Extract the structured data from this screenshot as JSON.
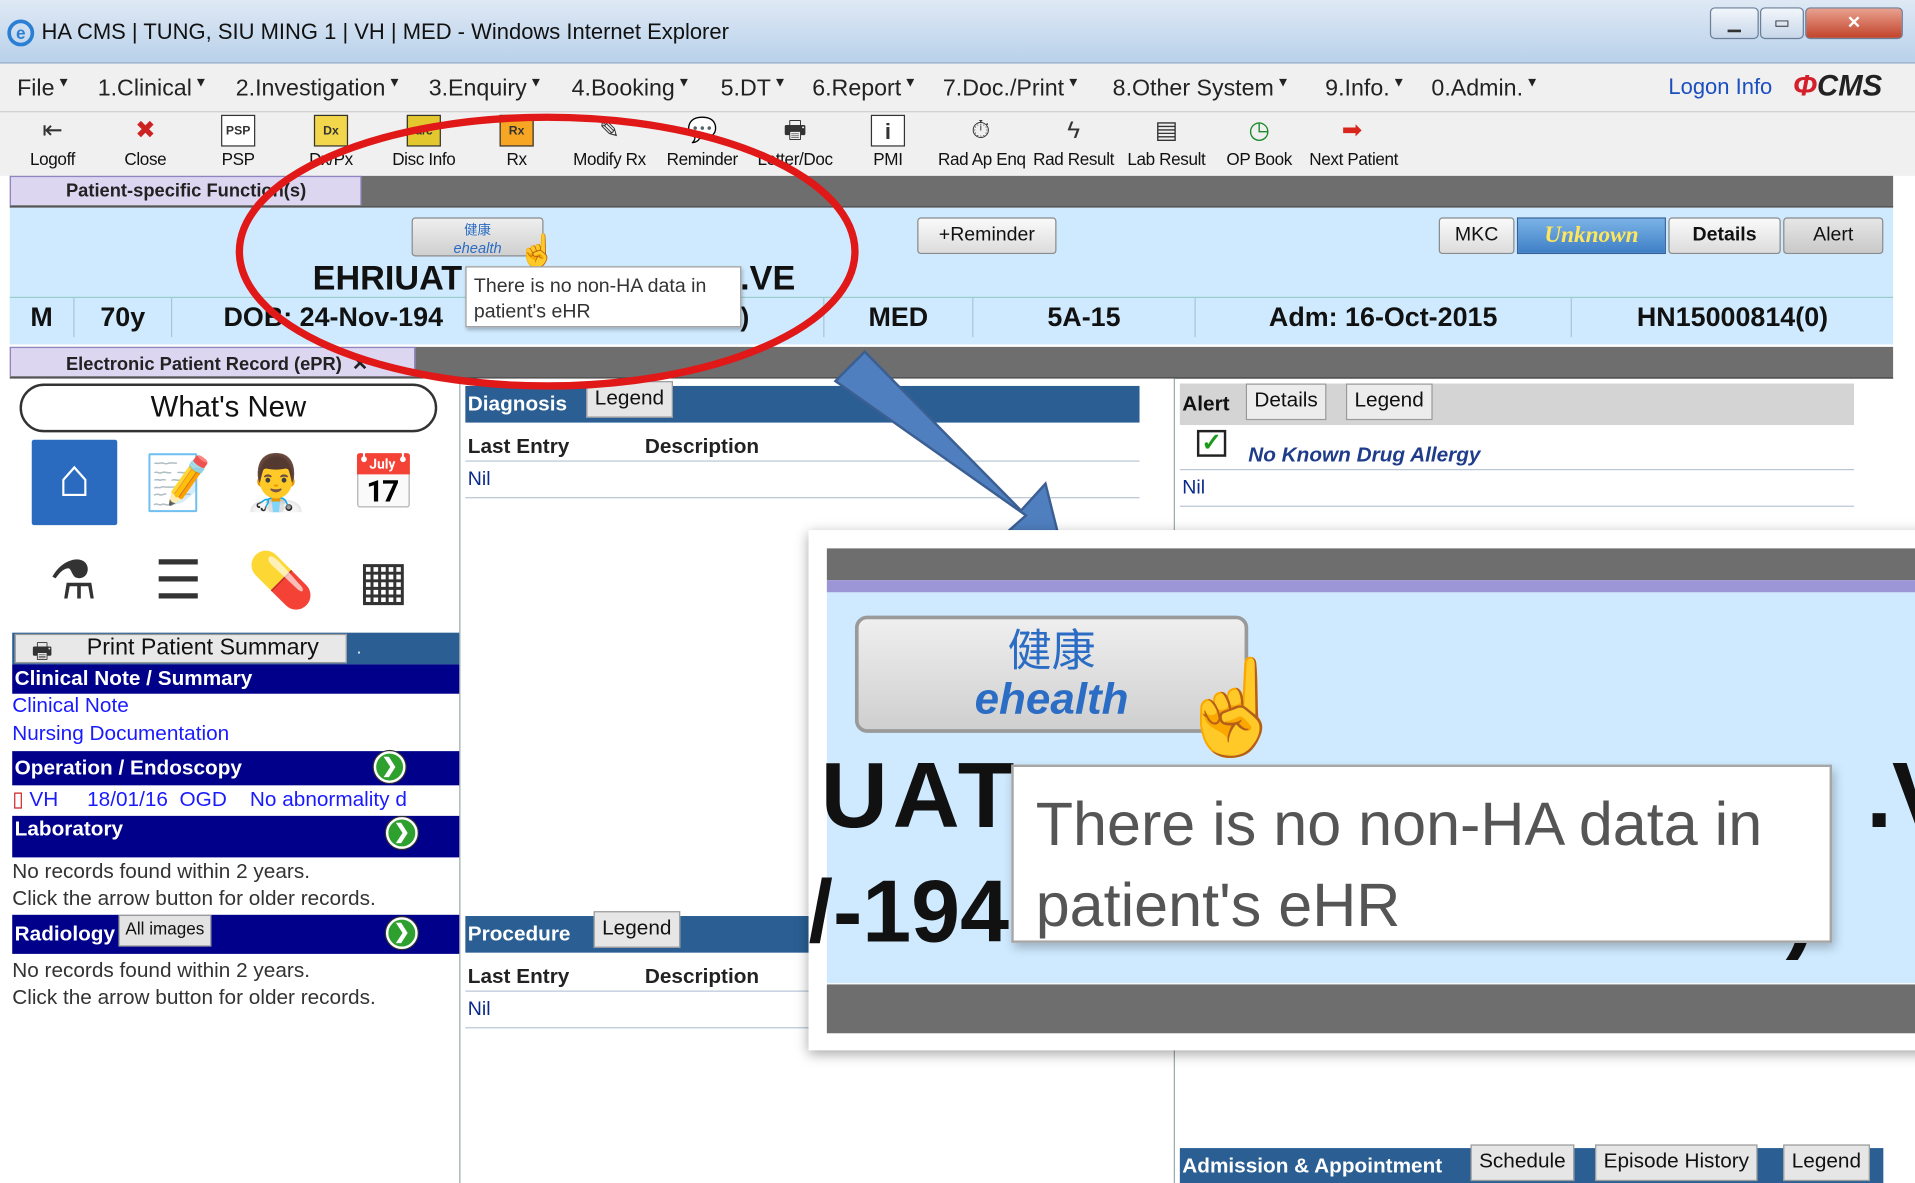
{
  "window": {
    "title": "HA CMS | TUNG, SIU MING 1 | VH | MED - Windows Internet Explorer"
  },
  "menu": [
    {
      "label": "File"
    },
    {
      "label": "1.Clinical"
    },
    {
      "label": "2.Investigation"
    },
    {
      "label": "3.Enquiry"
    },
    {
      "label": "4.Booking"
    },
    {
      "label": "5.DT"
    },
    {
      "label": "6.Report"
    },
    {
      "label": "7.Doc./Print"
    },
    {
      "label": "8.Other System"
    },
    {
      "label": "9.Info."
    },
    {
      "label": "0.Admin."
    }
  ],
  "logon_info": "Logon Info",
  "cms_logo": "CMS",
  "toolbar": [
    {
      "label": "Logoff",
      "icon": "logoff-icon"
    },
    {
      "label": "Close",
      "icon": "close-doc-icon"
    },
    {
      "label": "PSP",
      "icon": "psp-icon"
    },
    {
      "label": "Dx/Px",
      "icon": "dxpx-icon"
    },
    {
      "label": "Disc Info",
      "icon": "disc-info-icon"
    },
    {
      "label": "Rx",
      "icon": "rx-icon"
    },
    {
      "label": "Modify Rx",
      "icon": "modify-rx-icon"
    },
    {
      "label": "Reminder",
      "icon": "reminder-icon"
    },
    {
      "label": "Letter/Doc",
      "icon": "printer-icon"
    },
    {
      "label": "PMI",
      "icon": "info-icon"
    },
    {
      "label": "Rad Ap Enq",
      "icon": "rad-appointment-icon"
    },
    {
      "label": "Rad Result",
      "icon": "lightning-icon"
    },
    {
      "label": "Lab Result",
      "icon": "lab-result-icon"
    },
    {
      "label": "OP Book",
      "icon": "clock-icon"
    },
    {
      "label": "Next Patient",
      "icon": "next-arrow-icon"
    }
  ],
  "toolbar_box_icons": {
    "psp": "PSP",
    "dx": "Dx",
    "disc": "d/c",
    "rx": "Rx"
  },
  "tab_patient_functions": "Patient-specific Function(s)",
  "banner": {
    "ehealth_chinese": "健康",
    "ehealth_label": "ehealth",
    "tooltip": "There is no non-HA data in patient's eHR",
    "tooltip_line1": "There is no non-HA data in",
    "tooltip_line2": "patient's eHR",
    "reminder_button": "+Reminder",
    "mkc_button": "MKC",
    "unknown_badge": "Unknown",
    "details_button": "Details",
    "alert_button": "Alert",
    "name_left": "EHRIUAT",
    "name_right": ".VE",
    "sex": "M",
    "age": "70y",
    "dob_left": "DOB: 24-Nov-194",
    "dob_right": "9)",
    "specialty": "MED",
    "ward": "5A-15",
    "admission": "Adm: 16-Oct-2015",
    "hn": "HN15000814(0)"
  },
  "tab_epr": "Electronic Patient Record (ePR)",
  "tab_epr_close": "✕",
  "left": {
    "whats_new": "What's New",
    "print_summary": "Print Patient Summary",
    "print_summary_tail": ".",
    "clinical_note_header": "Clinical Note / Summary",
    "clinical_note_link": "Clinical Note",
    "nursing_link": "Nursing Documentation",
    "operation_header": "Operation / Endoscopy",
    "operation_row": {
      "hospital": "VH",
      "date": "18/01/16",
      "type": "OGD",
      "desc": "No abnormality d"
    },
    "laboratory_header": "Laboratory",
    "lab_msg1": "No records found within 2 years.",
    "lab_msg2": "Click the arrow button for older records.",
    "radiology_header": "Radiology",
    "all_images": "All images",
    "rad_msg1": "No records found within 2 years.",
    "rad_msg2": "Click the arrow button for older records."
  },
  "diagnosis": {
    "header": "Diagnosis",
    "legend": "Legend",
    "col1": "Last Entry",
    "col2": "Description",
    "nil": "Nil"
  },
  "procedure": {
    "header": "Procedure",
    "legend": "Legend",
    "col1": "Last Entry",
    "col2": "Description",
    "nil": "Nil"
  },
  "alert_panel": {
    "header": "Alert",
    "tab_details": "Details",
    "tab_legend": "Legend",
    "allergy": "No Known Drug Allergy",
    "nil": "Nil"
  },
  "admission": {
    "header": "Admission & Appointment",
    "tab_schedule": "Schedule",
    "tab_episode": "Episode History",
    "tab_legend": "Legend"
  },
  "colors": {
    "annotation_red": "#e01818",
    "arrow_blue": "#4f7fbf",
    "section_navy": "#00008b",
    "banner_blue": "#cfeaff",
    "panel_header": "#2b5f93"
  }
}
